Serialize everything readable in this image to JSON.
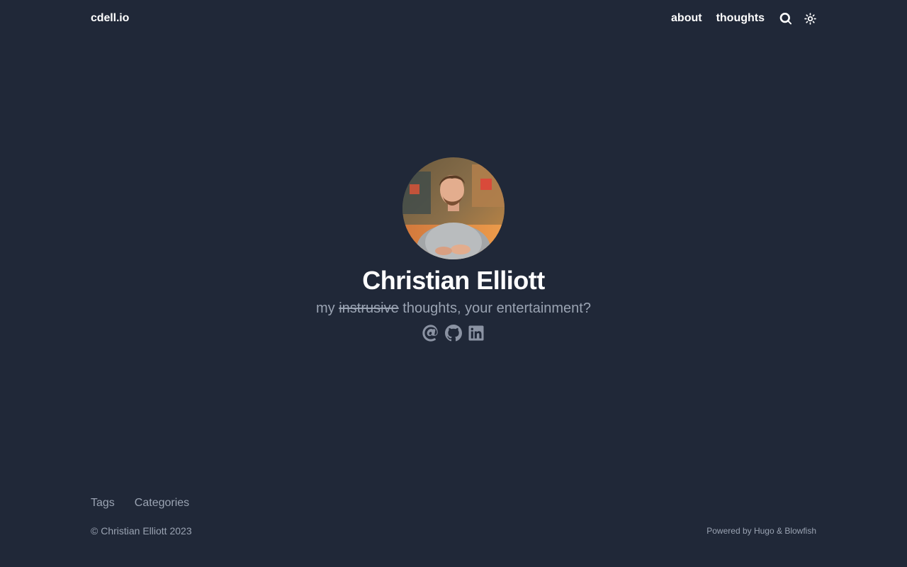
{
  "header": {
    "site_title": "cdell.io",
    "nav": [
      {
        "label": "about"
      },
      {
        "label": "thoughts"
      }
    ],
    "icons": [
      "search-icon",
      "sun-icon"
    ]
  },
  "hero": {
    "name": "Christian Elliott",
    "tagline_prefix": "my ",
    "tagline_struck": "instrusive",
    "tagline_suffix": " thoughts, your entertainment?",
    "socials": [
      "at-sign-icon",
      "github-icon",
      "linkedin-icon"
    ]
  },
  "footer": {
    "links": [
      {
        "label": "Tags"
      },
      {
        "label": "Categories"
      }
    ],
    "copyright": "© Christian Elliott 2023",
    "powered_prefix": "Powered by ",
    "powered_hugo": "Hugo",
    "powered_amp": " & ",
    "powered_blowfish": "Blowfish"
  },
  "colors": {
    "background": "#202838",
    "text": "#ffffff",
    "muted": "#9aa3b2",
    "icon_muted": "#8b93a3"
  }
}
